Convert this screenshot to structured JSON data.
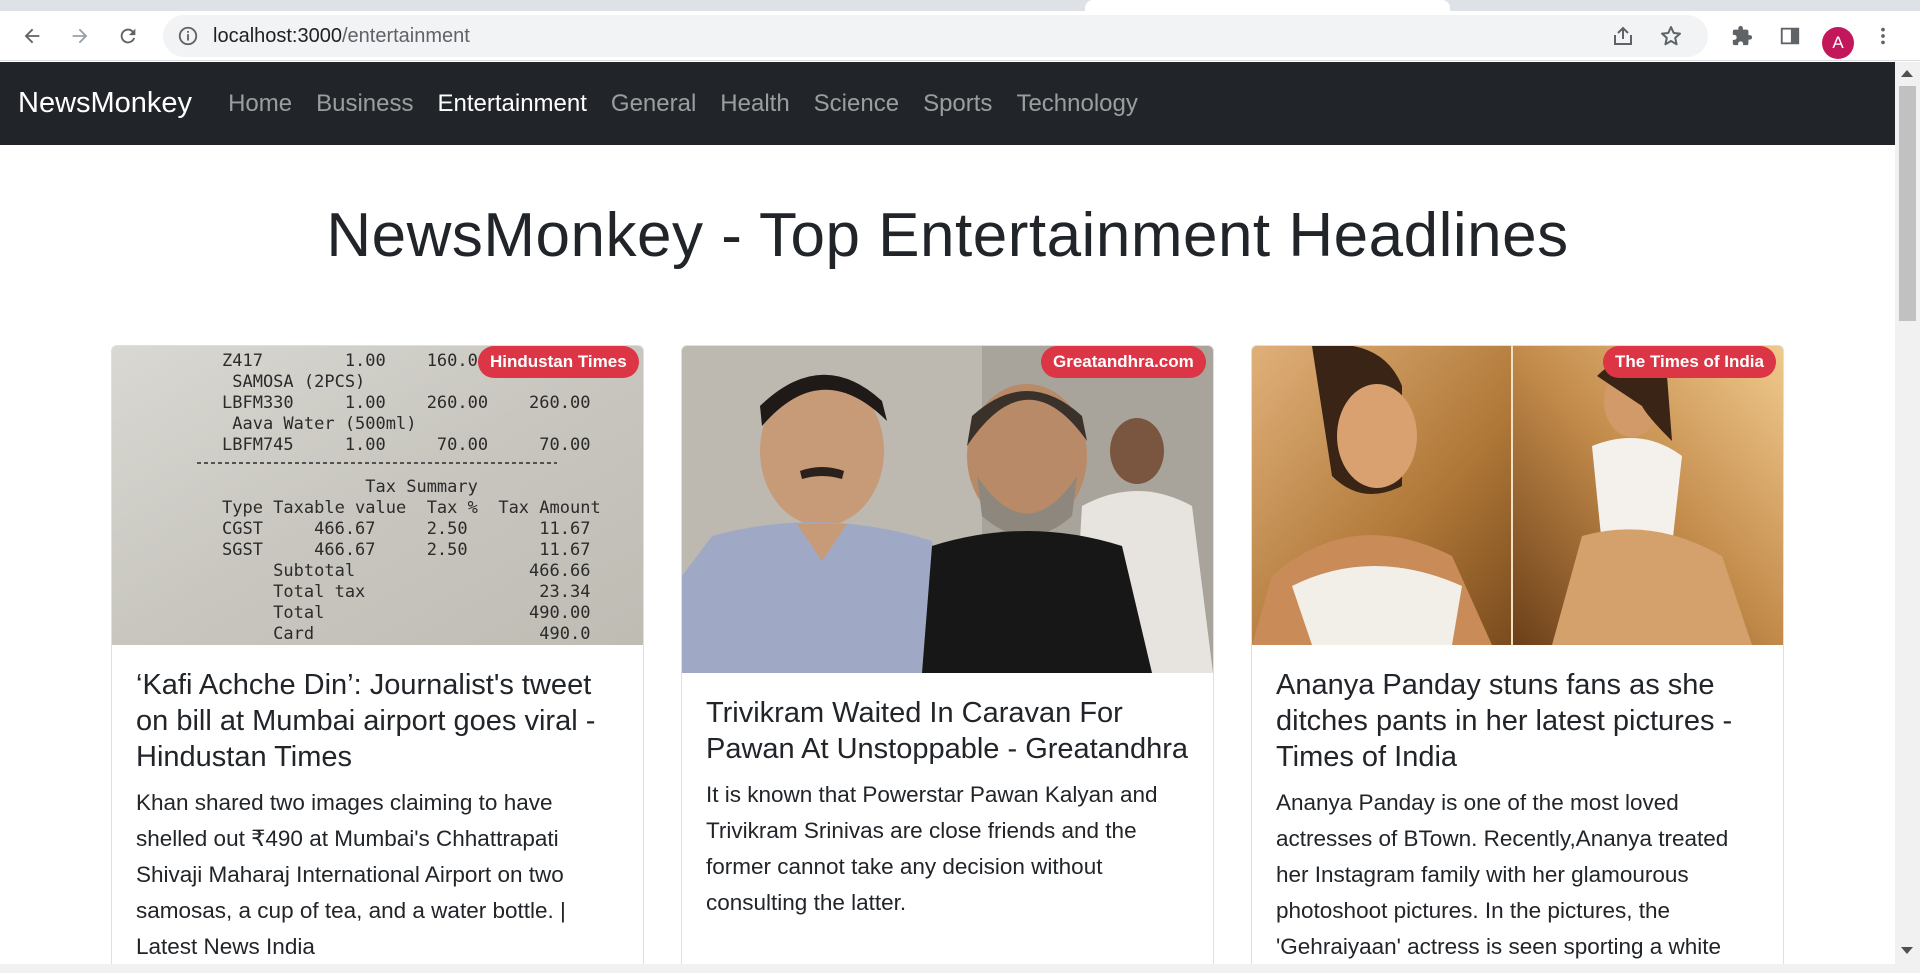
{
  "browser": {
    "url_host": "localhost:3000",
    "url_path": "/entertainment",
    "profile_initial": "A"
  },
  "navbar": {
    "brand": "NewsMonkey",
    "links": [
      "Home",
      "Business",
      "Entertainment",
      "General",
      "Health",
      "Science",
      "Sports",
      "Technology"
    ],
    "active": "Entertainment"
  },
  "page": {
    "heading": "NewsMonkey - Top Entertainment Headlines"
  },
  "cards": [
    {
      "source": "Hindustan Times",
      "title": "‘Kafi Achche Din’: Journalist's tweet on bill at Mumbai airport goes viral - Hindustan Times",
      "description": "Khan shared two images claiming to have shelled out ₹490 at Mumbai's Chhattrapati Shivaji Maharaj International Airport on two samosas, a cup of tea, and a water bottle. | Latest News India",
      "receipt_lines": [
        "Z417        1.00    160.00",
        " SAMOSA (2PCS)",
        "LBFM330     1.00    260.00    260.00",
        " Aava Water (500ml)",
        "LBFM745     1.00     70.00     70.00",
        "",
        "              Tax Summary",
        "Type Taxable value  Tax %  Tax Amount",
        "CGST     466.67     2.50       11.67",
        "SGST     466.67     2.50       11.67",
        "     Subtotal                 466.66",
        "     Total tax                 23.34",
        "     Total                    490.00",
        "     Card                      490.0"
      ]
    },
    {
      "source": "Greatandhra.com",
      "title": "Trivikram Waited In Caravan For Pawan At Unstoppable - Greatandhra",
      "description": "It is known that Powerstar Pawan Kalyan and Trivikram Srinivas are close friends and the former cannot take any decision without consulting the latter."
    },
    {
      "source": "The Times of India",
      "title": "Ananya Panday stuns fans as she ditches pants in her latest pictures - Times of India",
      "description": "Ananya Panday is one of the most loved actresses of BTown. Recently,Ananya treated her Instagram family with her glamourous photoshoot pictures. In the pictures, the 'Gehraiyaan' actress is seen sporting a white"
    }
  ],
  "colors": {
    "navbar_bg": "#212529",
    "badge_bg": "#dc3545",
    "text": "#212529"
  }
}
